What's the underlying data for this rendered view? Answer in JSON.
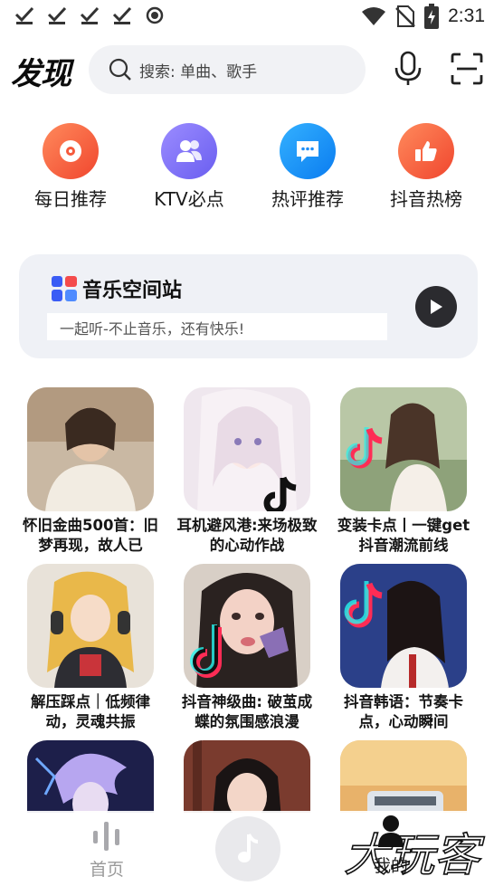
{
  "status_bar": {
    "time": "2:31",
    "notification_icons": [
      "check-icon",
      "check-icon",
      "check-icon",
      "check-icon",
      "record-icon"
    ],
    "system_icons": [
      "wifi-icon",
      "no-sim-icon",
      "battery-charging-icon"
    ]
  },
  "header": {
    "title": "发现",
    "search_placeholder": "搜索: 单曲、歌手"
  },
  "quick_entries": [
    {
      "label": "每日推荐",
      "icon": "disc-icon",
      "color": "#f55a3c"
    },
    {
      "label": "KTV必点",
      "icon": "people-icon",
      "color": "#7a6cf2"
    },
    {
      "label": "热评推荐",
      "icon": "comment-icon",
      "color": "#1e8ff7"
    },
    {
      "label": "抖音热榜",
      "icon": "thumbs-up-icon",
      "color": "#f55a3c"
    }
  ],
  "music_station": {
    "title": "音乐空间站",
    "subtitle": "一起听-不止音乐，还有快乐!"
  },
  "playlists": [
    {
      "title": "怀旧金曲500首：旧梦再现，故人已"
    },
    {
      "title": "耳机避风港:来场极致的心动作战"
    },
    {
      "title": "变装卡点丨一键get抖音潮流前线"
    },
    {
      "title": "解压踩点｜低频律动，灵魂共振"
    },
    {
      "title": "抖音神级曲: 破茧成蝶的氛围感浪漫"
    },
    {
      "title": "抖音韩语：节奏卡点，心动瞬间"
    },
    {
      "title": ""
    },
    {
      "title": ""
    },
    {
      "title": ""
    }
  ],
  "bottom_nav": {
    "home_label": "首页",
    "mine_label": "我的"
  },
  "watermark": "大玩客"
}
